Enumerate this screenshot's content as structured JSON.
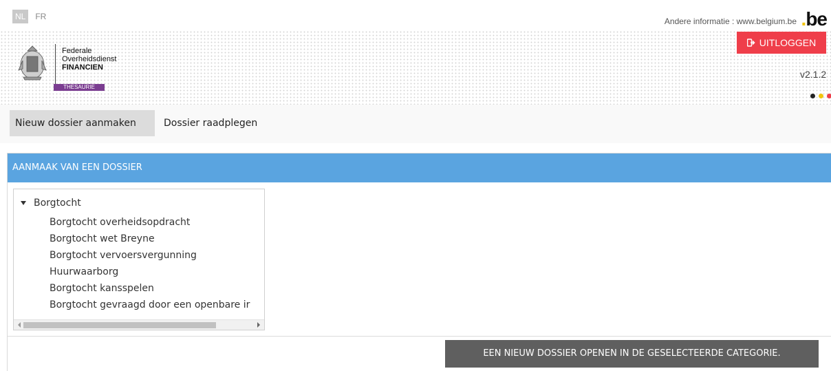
{
  "header": {
    "languages": [
      {
        "label": "NL",
        "active": true
      },
      {
        "label": "FR",
        "active": false
      }
    ],
    "info_text": "Andere informatie : www.belgium.be",
    "be_logo": ".be",
    "logout_label": "UITLOGGEN",
    "logout_icon": "sign-out-icon",
    "version": "v2.1.2",
    "colors": {
      "logout": "#ef3e4a",
      "thesaurie": "#7b3d91",
      "dot1": "#222222",
      "dot2": "#f1c40f",
      "dot3": "#ef3e4a"
    },
    "logo": {
      "line1": "Federale",
      "line2": "Overheidsdienst",
      "line3": "FINANCIEN",
      "badge": "THESAURIE"
    }
  },
  "nav": {
    "items": [
      {
        "label": "Nieuw dossier aanmaken",
        "active": true
      },
      {
        "label": "Dossier raadplegen",
        "active": false
      }
    ]
  },
  "panel": {
    "title": "AANMAAK VAN EEN DOSSIER",
    "header_color": "#5aa4e0",
    "tree": {
      "root": "Borgtocht",
      "expanded": true,
      "children": [
        "Borgtocht overheidsopdracht",
        "Borgtocht wet Breyne",
        "Borgtocht vervoersvergunning",
        "Huurwaarborg",
        "Borgtocht kansspelen",
        "Borgtocht gevraagd door een openbare ir"
      ]
    },
    "open_button": "EEN NIEUW DOSSIER OPENEN IN DE GESELECTEERDE CATEGORIE."
  }
}
